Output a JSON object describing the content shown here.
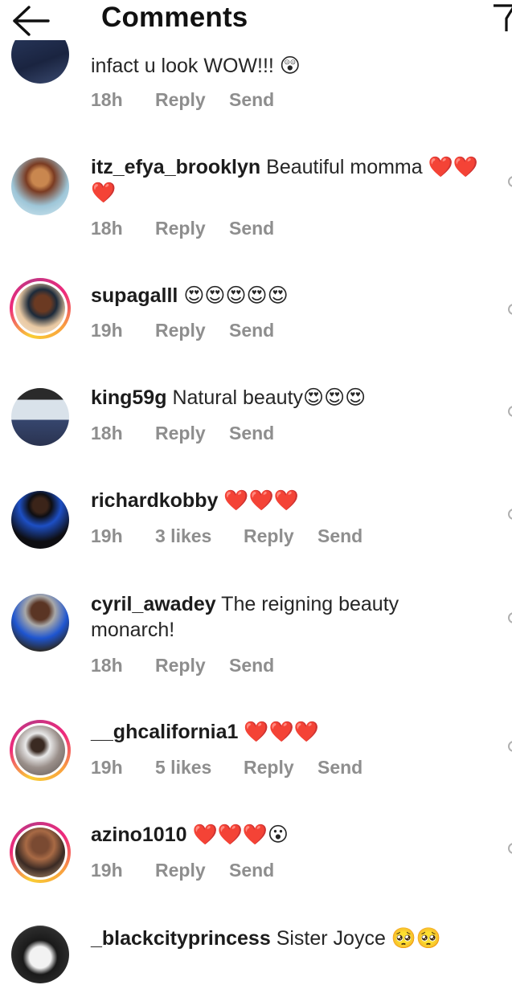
{
  "header": {
    "title": "Comments"
  },
  "colors": {
    "heart": "#e0202a",
    "meta": "#8e8e8e",
    "story_ring": "#ee2a7b"
  },
  "comments": [
    {
      "username": "",
      "text": "infact u look WOW!!! 😲",
      "time": "18h",
      "likes": "",
      "reply": "Reply",
      "send": "Send",
      "story_ring": false
    },
    {
      "username": "itz_efya_brooklyn",
      "text": "Beautiful momma ❤️❤️❤️",
      "time": "18h",
      "likes": "",
      "reply": "Reply",
      "send": "Send",
      "story_ring": false
    },
    {
      "username": "supagalll",
      "text": "😍😍😍😍😍",
      "time": "19h",
      "likes": "",
      "reply": "Reply",
      "send": "Send",
      "story_ring": true
    },
    {
      "username": "king59g",
      "text": "Natural beauty😍😍😍",
      "time": "18h",
      "likes": "",
      "reply": "Reply",
      "send": "Send",
      "story_ring": false
    },
    {
      "username": "richardkobby",
      "text": "❤️❤️❤️",
      "time": "19h",
      "likes": "3 likes",
      "reply": "Reply",
      "send": "Send",
      "story_ring": false
    },
    {
      "username": "cyril_awadey",
      "text": "The reigning beauty monarch!",
      "time": "18h",
      "likes": "",
      "reply": "Reply",
      "send": "Send",
      "story_ring": false
    },
    {
      "username": "__ghcalifornia1",
      "text": "❤️❤️❤️",
      "time": "19h",
      "likes": "5 likes",
      "reply": "Reply",
      "send": "Send",
      "story_ring": true
    },
    {
      "username": "azino1010",
      "text": "❤️❤️❤️😮",
      "time": "19h",
      "likes": "",
      "reply": "Reply",
      "send": "Send",
      "story_ring": true
    },
    {
      "username": "_blackcityprincess",
      "text": "Sister Joyce 🥺🥺",
      "time": "",
      "likes": "",
      "reply": "",
      "send": "",
      "story_ring": false
    }
  ]
}
